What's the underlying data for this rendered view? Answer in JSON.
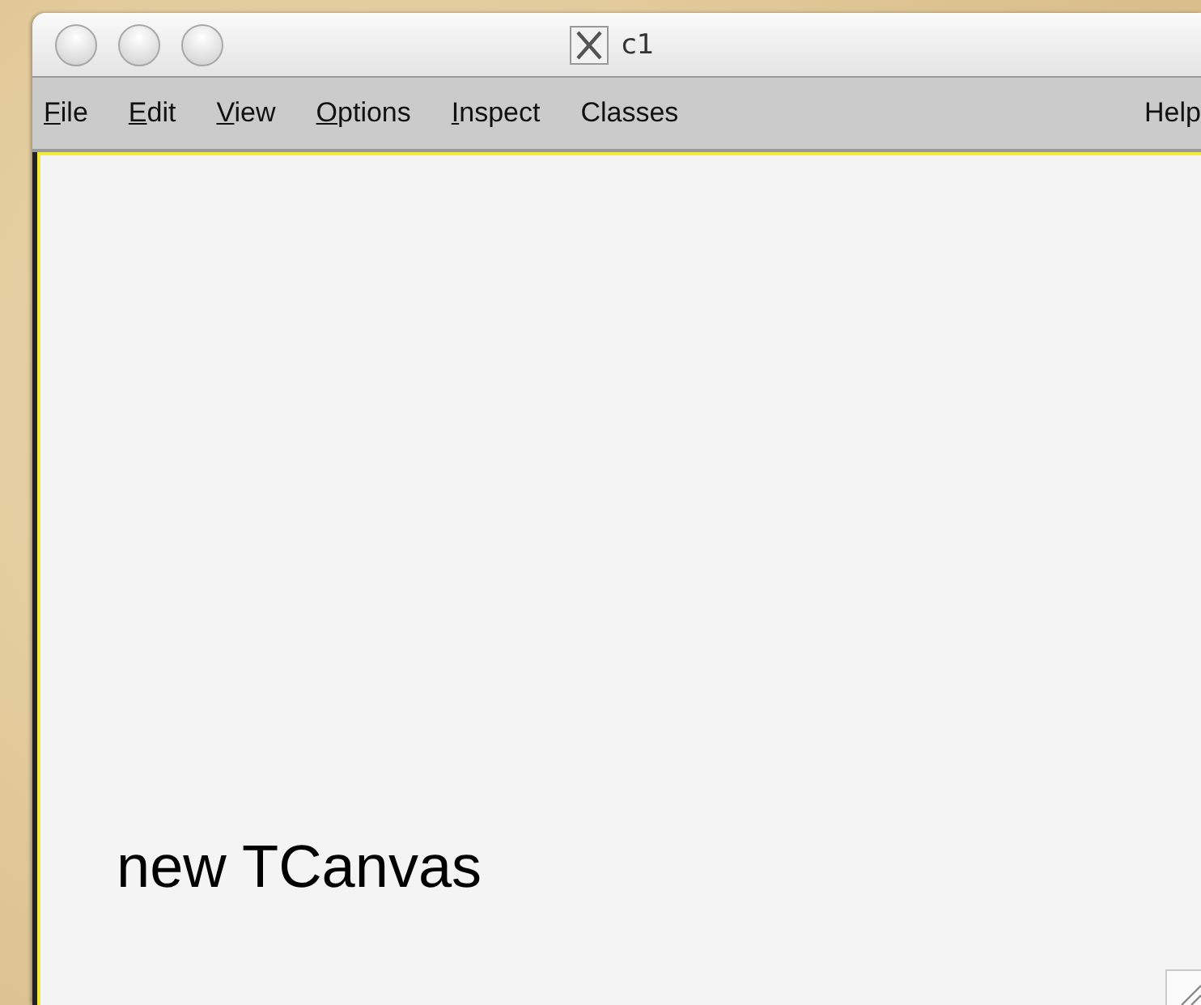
{
  "window": {
    "title": "c1"
  },
  "menu": [
    {
      "label": "File",
      "mnemonic": true
    },
    {
      "label": "Edit",
      "mnemonic": true
    },
    {
      "label": "View",
      "mnemonic": true
    },
    {
      "label": "Options",
      "mnemonic": true
    },
    {
      "label": "Inspect",
      "mnemonic": true
    },
    {
      "label": "Classes",
      "mnemonic": false
    }
  ],
  "help_menu": {
    "label": "Help",
    "mnemonic": false
  },
  "canvas": {
    "text": "new TCanvas"
  }
}
